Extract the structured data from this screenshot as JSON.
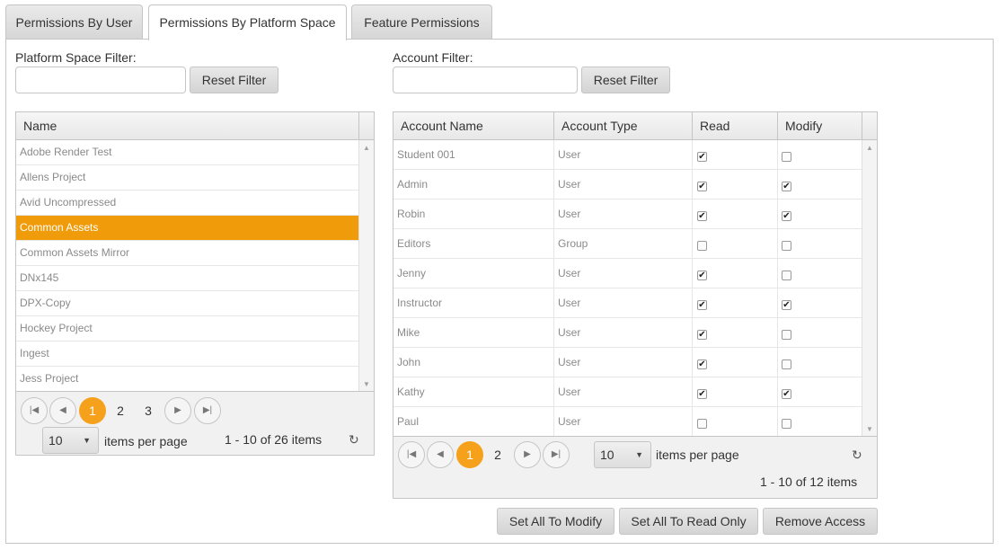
{
  "tabs": [
    {
      "label": "Permissions By User",
      "active": false
    },
    {
      "label": "Permissions By Platform Space",
      "active": true
    },
    {
      "label": "Feature Permissions",
      "active": false
    }
  ],
  "left": {
    "filter_label": "Platform Space Filter:",
    "filter_value": "",
    "reset_label": "Reset Filter",
    "column_header": "Name",
    "rows": [
      "Adobe Render Test",
      "Allens Project",
      "Avid Uncompressed",
      "Common Assets",
      "Common Assets Mirror",
      "DNx145",
      "DPX-Copy",
      "Hockey Project",
      "Ingest",
      "Jess Project"
    ],
    "selected_index": 3,
    "pager": {
      "pages": [
        "1",
        "2",
        "3"
      ],
      "current": "1",
      "page_size": "10",
      "per_page_label": "items per page",
      "info": "1 - 10 of 26 items"
    }
  },
  "right": {
    "filter_label": "Account Filter:",
    "filter_value": "",
    "reset_label": "Reset Filter",
    "headers": [
      "Account Name",
      "Account Type",
      "Read",
      "Modify"
    ],
    "rows": [
      {
        "name": "Student 001",
        "type": "User",
        "read": true,
        "modify": false
      },
      {
        "name": "Admin",
        "type": "User",
        "read": true,
        "modify": true
      },
      {
        "name": "Robin",
        "type": "User",
        "read": true,
        "modify": true
      },
      {
        "name": "Editors",
        "type": "Group",
        "read": false,
        "modify": false
      },
      {
        "name": "Jenny",
        "type": "User",
        "read": true,
        "modify": false
      },
      {
        "name": "Instructor",
        "type": "User",
        "read": true,
        "modify": true
      },
      {
        "name": "Mike",
        "type": "User",
        "read": true,
        "modify": false
      },
      {
        "name": "John",
        "type": "User",
        "read": true,
        "modify": false
      },
      {
        "name": "Kathy",
        "type": "User",
        "read": true,
        "modify": true
      },
      {
        "name": "Paul",
        "type": "User",
        "read": false,
        "modify": false
      }
    ],
    "pager": {
      "pages": [
        "1",
        "2"
      ],
      "current": "1",
      "page_size": "10",
      "per_page_label": "items per page",
      "info": "1 - 10 of 12 items"
    },
    "actions": [
      "Set All To Modify",
      "Set All To Read Only",
      "Remove Access"
    ]
  },
  "icons": {
    "first": "first-page-icon",
    "prev": "previous-page-icon",
    "next": "next-page-icon",
    "last": "last-page-icon",
    "refresh": "refresh-icon",
    "dropdown": "chevron-down-icon"
  },
  "colors": {
    "selected_row": "#f09b0a",
    "current_page": "#f5a11c",
    "border": "#c5c5c5"
  }
}
